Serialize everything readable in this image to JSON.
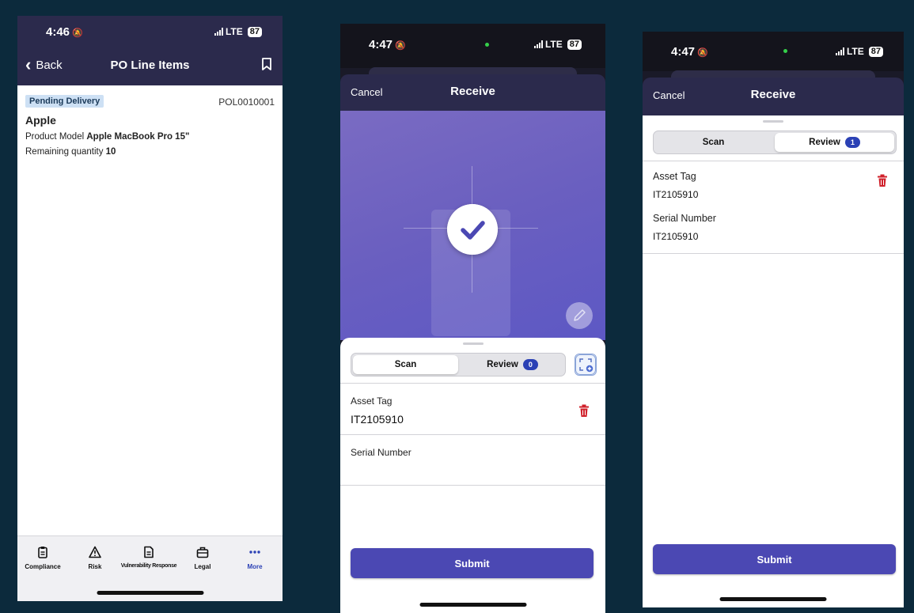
{
  "phone1": {
    "status": {
      "time": "4:46",
      "network": "LTE",
      "battery": "87"
    },
    "nav": {
      "back_label": "Back",
      "title": "PO Line Items"
    },
    "item": {
      "badge": "Pending Delivery",
      "number": "POL0010001",
      "vendor": "Apple",
      "model_label": "Product Model",
      "model_value": "Apple MacBook Pro 15\"",
      "qty_label": "Remaining quantity",
      "qty_value": "10"
    },
    "tabs": [
      "Compliance",
      "Risk",
      "Vulnerability Response",
      "Legal",
      "More"
    ],
    "accent": "#2b41b5"
  },
  "phone2": {
    "status": {
      "time": "4:47",
      "network": "LTE",
      "battery": "87"
    },
    "nav": {
      "cancel_label": "Cancel",
      "title": "Receive"
    },
    "segment": {
      "scan_label": "Scan",
      "review_label": "Review",
      "review_count": "0",
      "selected": "Scan"
    },
    "asset_tag_label": "Asset Tag",
    "asset_tag_value": "IT2105910",
    "serial_label": "Serial Number",
    "serial_value": "",
    "submit_label": "Submit"
  },
  "phone3": {
    "status": {
      "time": "4:47",
      "network": "LTE",
      "battery": "87"
    },
    "nav": {
      "cancel_label": "Cancel",
      "title": "Receive"
    },
    "segment": {
      "scan_label": "Scan",
      "review_label": "Review",
      "review_count": "1",
      "selected": "Review"
    },
    "asset_tag_label": "Asset Tag",
    "asset_tag_value": "IT2105910",
    "serial_label": "Serial Number",
    "serial_value": "IT2105910",
    "submit_label": "Submit"
  },
  "colors": {
    "nav_bg": "#2b2a4c",
    "submit_bg": "#4b48b3",
    "badge_bg": "#cde0f4",
    "delete": "#d0202a",
    "page_bg": "#0c2a3c"
  }
}
